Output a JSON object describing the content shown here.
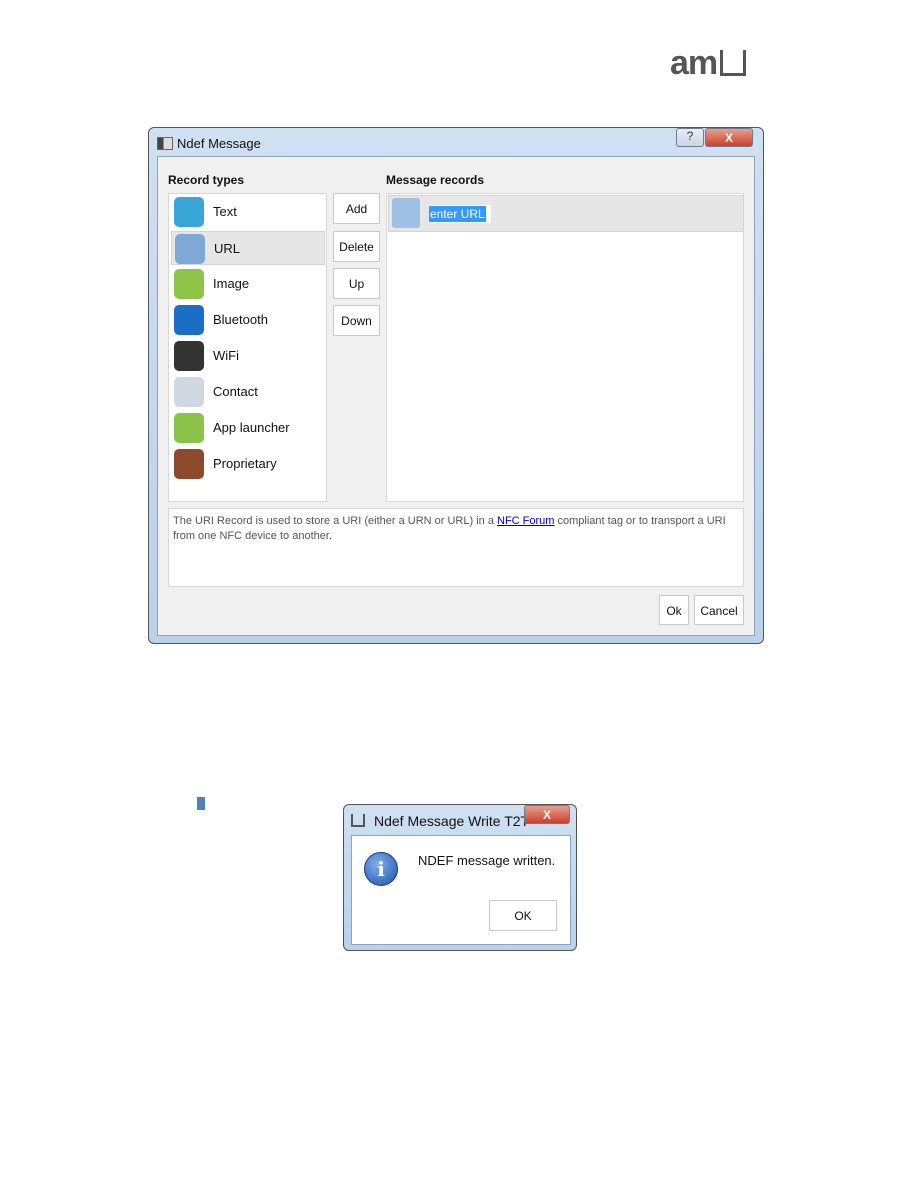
{
  "logo": {
    "text": "am"
  },
  "ndef_dialog": {
    "title": "Ndef Message",
    "help_label": "?",
    "close_label": "X",
    "record_types_label": "Record types",
    "message_records_label": "Message records",
    "record_types": [
      {
        "label": "Text",
        "icon": "text-icon",
        "color": "#3aa6d8"
      },
      {
        "label": "URL",
        "icon": "url-globe-icon",
        "color": "#7ea9d6",
        "selected": true
      },
      {
        "label": "Image",
        "icon": "image-icon",
        "color": "#8fc34a"
      },
      {
        "label": "Bluetooth",
        "icon": "bluetooth-icon",
        "color": "#1a6fc4"
      },
      {
        "label": "WiFi",
        "icon": "wifi-icon",
        "color": "#333333"
      },
      {
        "label": "Contact",
        "icon": "contact-card-icon",
        "color": "#cfd8e2"
      },
      {
        "label": "App launcher",
        "icon": "android-icon",
        "color": "#8bc34a"
      },
      {
        "label": "Proprietary",
        "icon": "briefcase-icon",
        "color": "#8b4a2b"
      }
    ],
    "buttons": {
      "add": "Add",
      "delete": "Delete",
      "up": "Up",
      "down": "Down",
      "ok": "Ok",
      "cancel": "Cancel"
    },
    "message_records": [
      {
        "value": "enter URL",
        "icon": "url-globe-icon"
      }
    ],
    "description": {
      "before": "The URI Record is used to store a URI (either a URN or URL) in a ",
      "link": "NFC Forum",
      "after": " compliant tag or to transport a URI from one NFC device to another."
    }
  },
  "write_dialog": {
    "title": "Ndef Message Write T2T",
    "close_label": "X",
    "message": "NDEF message written.",
    "ok": "OK",
    "icon": "info-icon"
  }
}
